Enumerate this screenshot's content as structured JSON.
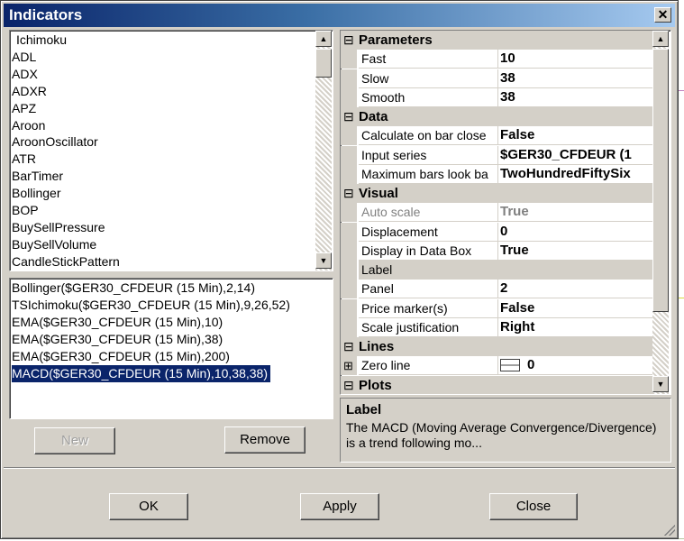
{
  "window": {
    "title": "Indicators"
  },
  "indicator_list": {
    "items": [
      "Ichimoku",
      "ADL",
      "ADX",
      "ADXR",
      "APZ",
      "Aroon",
      "AroonOscillator",
      "ATR",
      "BarTimer",
      "Bollinger",
      "BOP",
      "BuySellPressure",
      "BuySellVolume",
      "CandleStickPattern"
    ]
  },
  "applied_list": {
    "items": [
      "Bollinger($GER30_CFDEUR (15 Min),2,14)",
      "TSIchimoku($GER30_CFDEUR (15 Min),9,26,52)",
      "EMA($GER30_CFDEUR (15 Min),10)",
      "EMA($GER30_CFDEUR (15 Min),38)",
      "EMA($GER30_CFDEUR (15 Min),200)",
      "MACD($GER30_CFDEUR (15 Min),10,38,38)"
    ],
    "selected_index": 5
  },
  "buttons": {
    "new": "New",
    "remove": "Remove",
    "ok": "OK",
    "apply": "Apply",
    "close": "Close"
  },
  "properties": {
    "parameters": {
      "label": "Parameters",
      "expander": "⊟",
      "rows": [
        {
          "name": "Fast",
          "value": "10"
        },
        {
          "name": "Slow",
          "value": "38"
        },
        {
          "name": "Smooth",
          "value": "38"
        }
      ]
    },
    "data": {
      "label": "Data",
      "expander": "⊟",
      "rows": [
        {
          "name": "Calculate on bar close",
          "value": "False"
        },
        {
          "name": "Input series",
          "value": "$GER30_CFDEUR (1"
        },
        {
          "name": "Maximum bars look ba",
          "value": "TwoHundredFiftySix"
        }
      ]
    },
    "visual": {
      "label": "Visual",
      "expander": "⊟",
      "rows": [
        {
          "name": "Auto scale",
          "value": "True"
        },
        {
          "name": "Displacement",
          "value": "0"
        },
        {
          "name": "Display in Data Box",
          "value": "True"
        },
        {
          "name": "Label",
          "value": ""
        },
        {
          "name": "Panel",
          "value": "2"
        },
        {
          "name": "Price marker(s)",
          "value": "False"
        },
        {
          "name": "Scale justification",
          "value": "Right"
        }
      ]
    },
    "lines": {
      "label": "Lines",
      "expander": "⊟",
      "rows": [
        {
          "name": "Zero line",
          "value": "0",
          "expander": "⊞"
        }
      ]
    },
    "plots": {
      "label": "Plots",
      "expander": "⊟"
    }
  },
  "description": {
    "title": "Label",
    "text": "The MACD (Moving Average Convergence/Divergence) is a trend following mo..."
  }
}
